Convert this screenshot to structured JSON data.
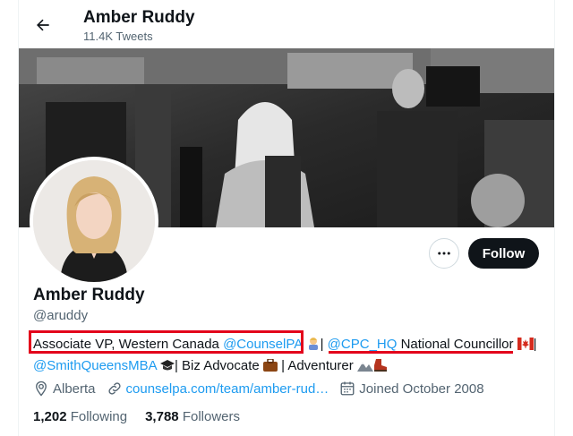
{
  "header": {
    "name": "Amber Ruddy",
    "tweet_count": "11.4K Tweets"
  },
  "profile": {
    "display_name": "Amber Ruddy",
    "handle": "@aruddy",
    "follow_label": "Follow",
    "bio": {
      "text1": "Associate VP, Western Canada ",
      "mention1": "@CounselPA",
      "text2": "| ",
      "mention2": "@CPC_HQ",
      "text3": " National Councillor ",
      "text4": "| ",
      "mention3": "@SmithQueensMBA",
      "text5": "| Biz Advocate ",
      "text6": " | Adventurer "
    },
    "location": "Alberta",
    "website": "counselpa.com/team/amber-rud…",
    "joined": "Joined October 2008",
    "following_count": "1,202",
    "following_label": "Following",
    "followers_count": "3,788",
    "followers_label": "Followers"
  },
  "icons": [
    "back-arrow-icon",
    "more-dots-icon",
    "location-pin-icon",
    "link-icon",
    "calendar-icon"
  ],
  "colors": {
    "accent": "#1d9bf0",
    "annotation": "#e3001b",
    "follow_bg": "#0f1419"
  }
}
